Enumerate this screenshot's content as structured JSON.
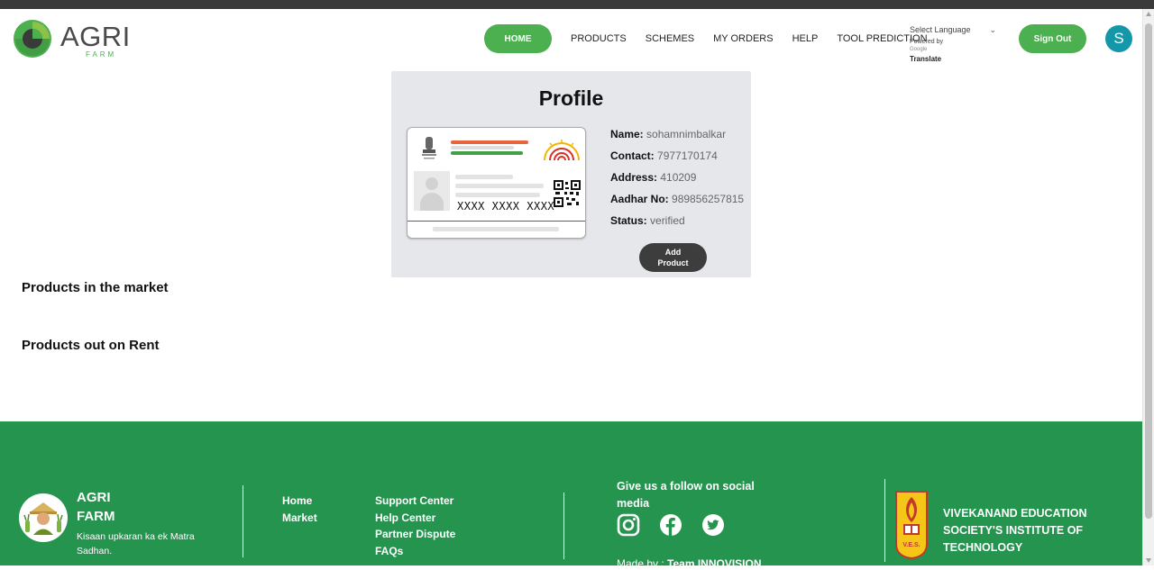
{
  "header": {
    "logo_text": "AGRI",
    "logo_sub": "FARM",
    "nav": {
      "home": "HOME",
      "products": "PRODUCTS",
      "schemes": "SCHEMES",
      "my_orders": "MY ORDERS",
      "help": "HELP",
      "tool_prediction": "TOOL PREDICTION"
    },
    "language": {
      "select": "Select Language",
      "powered_by": "Powered by",
      "google": "Google",
      "translate": "Translate"
    },
    "sign_out": "Sign Out",
    "avatar_initial": "S"
  },
  "profile": {
    "title": "Profile",
    "card_number": "XXXX  XXXX  XXXX",
    "fields": {
      "name_label": "Name:",
      "name_value": "sohamnimbalkar",
      "contact_label": "Contact:",
      "contact_value": "7977170174",
      "address_label": "Address:",
      "address_value": "410209",
      "aadhar_label": "Aadhar No:",
      "aadhar_value": "989856257815",
      "status_label": "Status:",
      "status_value": "verified"
    },
    "add_product_line1": "Add",
    "add_product_line2": "Product"
  },
  "sections": {
    "market": "Products in the market",
    "rent": "Products out on Rent"
  },
  "footer": {
    "brand_line1": "AGRI",
    "brand_line2": "FARM",
    "tagline": "Kisaan upkaran ka ek Matra Sadhan.",
    "links_col1": [
      "Home",
      "Market"
    ],
    "links_col2": [
      "Support Center",
      "Help Center",
      "Partner Dispute",
      "FAQs"
    ],
    "social_title": "Give us a follow on social media",
    "made_by_prefix": "Made by :",
    "made_by_team": "Team INNOVISION",
    "institute": "VIVEKANAND EDUCATION SOCIETY'S INSTITUTE OF TECHNOLOGY",
    "ves_logo_text": "V.E.S."
  },
  "colors": {
    "accent_green": "#4caf50",
    "footer_green": "#24944f",
    "avatar_teal": "#1497a8",
    "card_bg": "#e5e7eb"
  },
  "icons": [
    "instagram-icon",
    "facebook-icon",
    "twitter-icon",
    "chevron-down-icon"
  ]
}
